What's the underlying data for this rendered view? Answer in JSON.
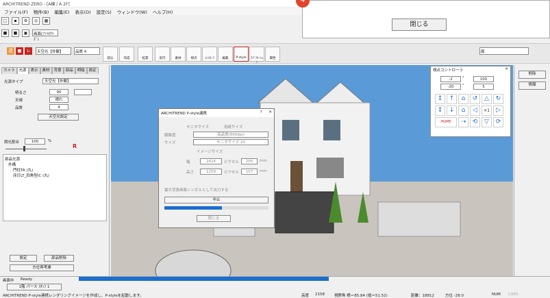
{
  "window": {
    "title": "ARCHITREND ZERO - [A棟 / A 2F]"
  },
  "menu": [
    "ファイル(F)",
    "物件(B)",
    "編集(E)",
    "表示(D)",
    "設定(S)",
    "ウィンドウ(W)",
    "ヘルプ(H)"
  ],
  "toolbar2": {
    "view_select": "画面(ﾌｧｲﾙｻｲｽﾞ)"
  },
  "notification": {
    "badge": "4",
    "close_label": "閉じる"
  },
  "mainbar": {
    "render_select": "天空光【外観】",
    "quality_select": "品質 4",
    "buttons": [
      "読込",
      "作成",
      "拡張",
      "実行",
      "素材",
      "視点",
      "ｺﾝﾄﾛｰﾗ",
      "編集",
      "P-style",
      "ｱﾌﾟﾘｹｰｼｮﾝ",
      "属性"
    ],
    "right_select": "面"
  },
  "left_panel": {
    "tabs": [
      "カメラ",
      "光源",
      "表示",
      "素材",
      "背景",
      "部品",
      "明暗",
      "設定"
    ],
    "light_type_label": "光源タイプ",
    "light_type_value": "天空光【外観】",
    "brightness_label": "明るさ",
    "brightness_value": "90",
    "weather_label": "天候",
    "weather_value": "晴れ",
    "quality_label": "品質",
    "quality_value": "4",
    "sky_settings_button": "天空光設定",
    "dim_ratio_label": "調光割合",
    "dim_ratio_value": "100",
    "dim_ratio_unit": "%",
    "tree": [
      "部品光源",
      "外構",
      "門柱TA (丸)",
      "床灯LT_四角型IC (丸)"
    ],
    "settings_button": "設定",
    "delete_parts_button": "部品削除",
    "recalc_button": "方位再考慮"
  },
  "dialog": {
    "title": "ARCHITREND P-style連携",
    "help": "?",
    "close": "✕",
    "radio_monitor": "モニタサイズ",
    "radio_paper": "用紙サイズ",
    "res_label": "解像度",
    "res_value": "高品質(600dpi)",
    "size_label": "サイズ",
    "size_value": "モニタサイズ 20",
    "image_size_label": "イメージサイズ",
    "width_label": "幅",
    "width_px": "2424",
    "width_px_unit": "ピクセル",
    "width_mm": "205",
    "height_label": "高さ",
    "height_px": "1259",
    "height_px_unit": "ピクセル",
    "height_mm": "107",
    "mm_unit": "mm",
    "checkbox_label": "最大背景画像シンボルとして出力する",
    "stop_button": "中止",
    "progress": 0.55,
    "close_button": "閉じる"
  },
  "viewpoint_controller": {
    "title": "視点コントローラ",
    "angle1": "-2",
    "angle2": "-20",
    "deg": "°",
    "val1": "100",
    "val2": "5",
    "scale": "×1",
    "home": "HOME"
  },
  "right_panel": {
    "items": [
      "削除",
      "情報"
    ]
  },
  "status": {
    "mode_label": "画面中",
    "ready": "Ready",
    "tab_label": "1階 パース ｽﾀｯﾌ 1",
    "message": "ARCHITREND P-style連携レンダリングイメージを作成し、P-styleを起動します。",
    "altitude_label": "高度",
    "altitude_value": "2158",
    "viewfield": "視野角 横＝85.84 (縦＝51.52)",
    "distance": "距離：18812",
    "direction": "方位 -28.0",
    "num": "NUM",
    "caps": "CAPS"
  },
  "colors": {
    "accent": "#1a6ed0",
    "sky": "#5a9ad6",
    "badge": "#e0442b"
  }
}
